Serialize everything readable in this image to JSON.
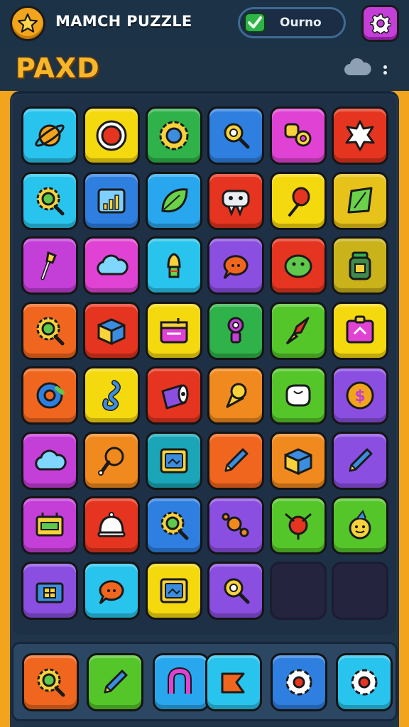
{
  "header": {
    "app_title": "MAMCH PUZZLE",
    "status_label": "Ourno",
    "icons": [
      "star-icon",
      "check-icon",
      "gear-icon"
    ]
  },
  "subheader": {
    "title": "PAXD",
    "icons": [
      "cloud-icon",
      "more-icon"
    ]
  },
  "colors": {
    "accent": "#f2a51c",
    "frame": "#f2a51c",
    "board": "#1d3045",
    "settings": "#c43ed8",
    "status_check": "#2fb24a"
  },
  "board": {
    "rows": [
      [
        {
          "icon": "planet-icon",
          "color": "#29c4ee"
        },
        {
          "icon": "red-button-icon",
          "color": "#f5d90f"
        },
        {
          "icon": "sun-gear-icon",
          "color": "#2fb24a"
        },
        {
          "icon": "magnifier-icon",
          "color": "#2e7fe0"
        },
        {
          "icon": "rings-icon",
          "color": "#e043d4"
        },
        {
          "icon": "star-burst-icon",
          "color": "#e5341f"
        }
      ],
      [
        {
          "icon": "search-gear-icon",
          "color": "#29c4ee"
        },
        {
          "icon": "chart-icon",
          "color": "#2e7fe0"
        },
        {
          "icon": "leaf-icon",
          "color": "#29a7ee"
        },
        {
          "icon": "robot-icon",
          "color": "#e5341f"
        },
        {
          "icon": "balloon-icon",
          "color": "#f5d90f"
        },
        {
          "icon": "map-icon",
          "color": "#e6c21a"
        }
      ],
      [
        {
          "icon": "torch-icon",
          "color": "#c43ed8"
        },
        {
          "icon": "cloud-icon",
          "color": "#e043d4"
        },
        {
          "icon": "bell-icon",
          "color": "#29c4ee"
        },
        {
          "icon": "chat-icon",
          "color": "#8a4fe0"
        },
        {
          "icon": "blob-icon",
          "color": "#e5341f"
        },
        {
          "icon": "jar-icon",
          "color": "#c9b21a"
        }
      ],
      [
        {
          "icon": "search-gear-icon",
          "color": "#f0661e"
        },
        {
          "icon": "box-icon",
          "color": "#e5341f"
        },
        {
          "icon": "calendar-icon",
          "color": "#f5d90f"
        },
        {
          "icon": "key-icon",
          "color": "#2fb24a"
        },
        {
          "icon": "rocket-icon",
          "color": "#55c62a"
        },
        {
          "icon": "puzzle-icon",
          "color": "#f5d90f"
        }
      ],
      [
        {
          "icon": "donut-icon",
          "color": "#f0661e"
        },
        {
          "icon": "seahorse-icon",
          "color": "#f5d90f"
        },
        {
          "icon": "roll-icon",
          "color": "#e5341f"
        },
        {
          "icon": "cone-icon",
          "color": "#f08a1e"
        },
        {
          "icon": "hand-icon",
          "color": "#55c62a"
        },
        {
          "icon": "coin-icon",
          "color": "#8a4fe0"
        }
      ],
      [
        {
          "icon": "cloud-icon",
          "color": "#c43ed8"
        },
        {
          "icon": "drumstick-icon",
          "color": "#f08a1e"
        },
        {
          "icon": "frame-icon",
          "color": "#1aa6b8"
        },
        {
          "icon": "pencil-icon",
          "color": "#f0661e"
        },
        {
          "icon": "box-icon",
          "color": "#f08a1e"
        },
        {
          "icon": "pencil-icon",
          "color": "#8a4fe0"
        }
      ],
      [
        {
          "icon": "battery-icon",
          "color": "#c43ed8"
        },
        {
          "icon": "bell-dome-icon",
          "color": "#e5341f"
        },
        {
          "icon": "search-gear-icon",
          "color": "#2e7fe0"
        },
        {
          "icon": "molecule-icon",
          "color": "#8a4fe0"
        },
        {
          "icon": "pin-icon",
          "color": "#55c62a"
        },
        {
          "icon": "smiley-icon",
          "color": "#55c62a"
        }
      ],
      [
        {
          "icon": "gift-icon",
          "color": "#8a4fe0"
        },
        {
          "icon": "chat-icon",
          "color": "#29c4ee"
        },
        {
          "icon": "frame-icon",
          "color": "#f5d90f"
        },
        {
          "icon": "magnifier-icon",
          "color": "#8a4fe0"
        },
        {
          "icon": "empty",
          "color": ""
        },
        {
          "icon": "empty",
          "color": ""
        }
      ]
    ]
  },
  "tray": [
    {
      "icon": "search-gear-icon",
      "color": "#f0661e"
    },
    {
      "icon": "pencil-icon",
      "color": "#55c62a"
    },
    {
      "icon": "magnet-icon",
      "color": "#29a7ee"
    },
    {
      "icon": "heart-icon",
      "color": "#29c4ee"
    },
    {
      "icon": "gear-icon",
      "color": "#2e7fe0"
    },
    {
      "icon": "gear-icon",
      "color": "#29c4ee"
    }
  ]
}
